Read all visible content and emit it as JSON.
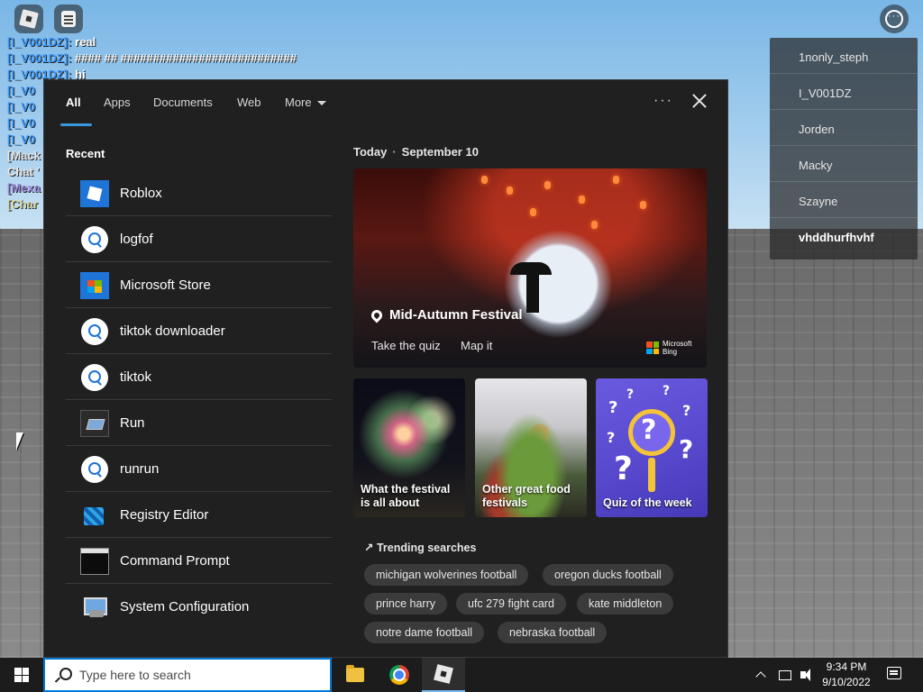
{
  "roblox": {
    "chat": [
      {
        "name": "[I_V001DZ]:",
        "msg": " real",
        "cls": ""
      },
      {
        "name": "[I_V001DZ]:",
        "msg": " #### ## ###########################",
        "cls": ""
      },
      {
        "name": "[I_V001DZ]:",
        "msg": " hi",
        "cls": ""
      },
      {
        "name": "[I_V0",
        "msg": "",
        "cls": ""
      },
      {
        "name": "[I_V0",
        "msg": "",
        "cls": ""
      },
      {
        "name": "[I_V0",
        "msg": "",
        "cls": ""
      },
      {
        "name": "[I_V0",
        "msg": "",
        "cls": ""
      },
      {
        "name": "[Mack",
        "msg": "",
        "cls": "c2"
      },
      {
        "name": "Chat '",
        "msg": "",
        "cls": "c2"
      },
      {
        "name": "[Mexa",
        "msg": "",
        "cls": "c3"
      },
      {
        "name": "[Char",
        "msg": "",
        "cls": "c4"
      }
    ],
    "players": [
      "1nonly_steph",
      "I_V001DZ",
      "Jorden",
      "Macky",
      "Szayne",
      "vhddhurfhvhf"
    ]
  },
  "search": {
    "tabs": {
      "all": "All",
      "apps": "Apps",
      "documents": "Documents",
      "web": "Web",
      "more": "More"
    },
    "more_options": "···",
    "recent_title": "Recent",
    "recent": [
      {
        "label": "Roblox",
        "icon": "roblox-icon"
      },
      {
        "label": "logfof",
        "icon": "search-icon"
      },
      {
        "label": "Microsoft Store",
        "icon": "store-icon"
      },
      {
        "label": "tiktok downloader",
        "icon": "search-icon"
      },
      {
        "label": "tiktok",
        "icon": "search-icon"
      },
      {
        "label": "Run",
        "icon": "run-icon"
      },
      {
        "label": "runrun",
        "icon": "search-icon"
      },
      {
        "label": "Registry Editor",
        "icon": "registry-editor-icon"
      },
      {
        "label": "Command Prompt",
        "icon": "command-prompt-icon"
      },
      {
        "label": "System Configuration",
        "icon": "system-configuration-icon"
      }
    ],
    "today": {
      "label": "Today",
      "date": "September 10"
    },
    "hero": {
      "title": "Mid-Autumn Festival",
      "take_quiz": "Take the quiz",
      "map_it": "Map it",
      "brand_line1": "Microsoft",
      "brand_line2": "Bing"
    },
    "cards": [
      {
        "label": "What the festival is all about"
      },
      {
        "label": "Other great food festivals"
      },
      {
        "label": "Quiz of the week"
      }
    ],
    "trending_title": "Trending searches",
    "trending_icon": "trending-arrow-icon",
    "trending": [
      "michigan wolverines football",
      "oregon ducks football",
      "prince harry",
      "ufc 279 fight card",
      "kate middleton",
      "notre dame football",
      "nebraska football"
    ]
  },
  "taskbar": {
    "search_placeholder": "Type here to search",
    "time": "9:34 PM",
    "date": "9/10/2022"
  },
  "colors": {
    "accent": "#0078d7",
    "tab_underline": "#3a96dd",
    "flyout_bg": "#202020"
  }
}
